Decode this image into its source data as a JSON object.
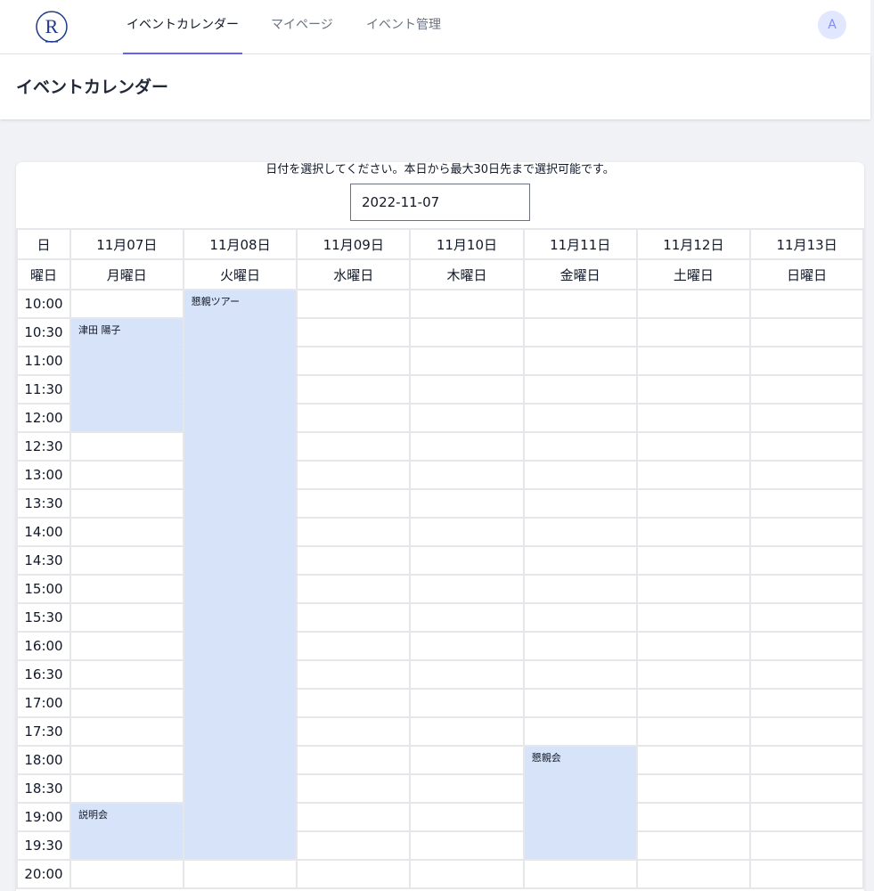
{
  "nav": {
    "tabs": [
      {
        "label": "イベントカレンダー",
        "active": true
      },
      {
        "label": "マイページ",
        "active": false
      },
      {
        "label": "イベント管理",
        "active": false
      }
    ],
    "avatar_initial": "A",
    "accent_color": "#6366f1"
  },
  "page": {
    "title": "イベントカレンダー"
  },
  "calendar": {
    "instruction": "日付を選択してください。本日から最大30日先まで選択可能です。",
    "selected_date": "2022-11-07",
    "date_header_label": "日",
    "weekday_header_label": "曜日",
    "days": [
      {
        "date": "11月07日",
        "weekday": "月曜日"
      },
      {
        "date": "11月08日",
        "weekday": "火曜日"
      },
      {
        "date": "11月09日",
        "weekday": "水曜日"
      },
      {
        "date": "11月10日",
        "weekday": "木曜日"
      },
      {
        "date": "11月11日",
        "weekday": "金曜日"
      },
      {
        "date": "11月12日",
        "weekday": "土曜日"
      },
      {
        "date": "11月13日",
        "weekday": "日曜日"
      }
    ],
    "times": [
      "10:00",
      "10:30",
      "11:00",
      "11:30",
      "12:00",
      "12:30",
      "13:00",
      "13:30",
      "14:00",
      "14:30",
      "15:00",
      "15:30",
      "16:00",
      "16:30",
      "17:00",
      "17:30",
      "18:00",
      "18:30",
      "19:00",
      "19:30",
      "20:00"
    ],
    "events": [
      {
        "title": "懇親ツアー",
        "day": 1,
        "start": "10:00",
        "end": "19:30"
      },
      {
        "title": "津田 陽子",
        "day": 0,
        "start": "10:30",
        "end": "12:00"
      },
      {
        "title": "説明会",
        "day": 0,
        "start": "19:00",
        "end": "19:30"
      },
      {
        "title": "懇親会",
        "day": 4,
        "start": "18:00",
        "end": "19:30"
      }
    ],
    "event_color": "#d6e3f8"
  }
}
